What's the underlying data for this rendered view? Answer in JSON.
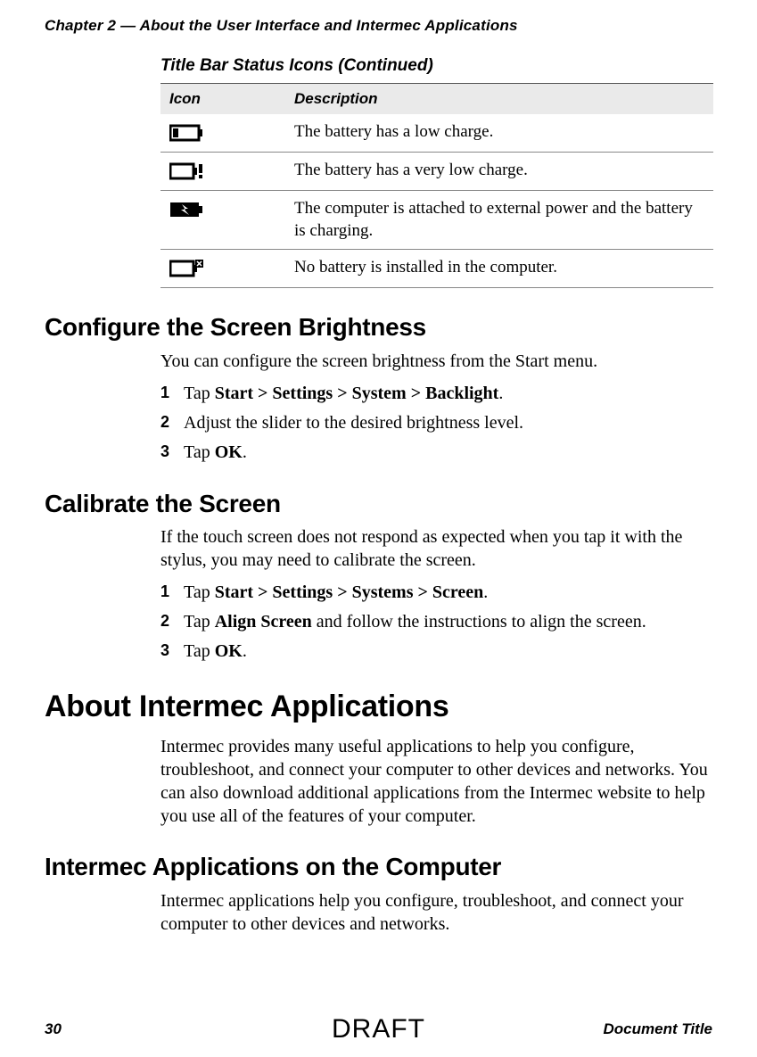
{
  "header": "Chapter 2 — About the User Interface and Intermec Applications",
  "table": {
    "title": "Title Bar Status Icons  (Continued)",
    "col_icon": "Icon",
    "col_desc": "Description",
    "rows": {
      "r0": {
        "icon_name": "battery-low-icon",
        "desc": "The battery has a low charge."
      },
      "r1": {
        "icon_name": "battery-very-low-icon",
        "desc": "The battery has a very low charge."
      },
      "r2": {
        "icon_name": "battery-charging-icon",
        "desc": "The computer is attached to external power and the battery is charging."
      },
      "r3": {
        "icon_name": "battery-missing-icon",
        "desc": "No battery is installed in the computer."
      }
    }
  },
  "sections": {
    "brightness": {
      "title": "Configure the Screen Brightness",
      "intro": "You can configure the screen brightness from the Start menu.",
      "steps": {
        "s1_pre": "Tap ",
        "s1_bold": "Start > Settings > System > Backlight",
        "s1_post": ".",
        "s2": "Adjust the slider to the desired brightness level.",
        "s3_pre": "Tap ",
        "s3_bold": "OK",
        "s3_post": "."
      }
    },
    "calibrate": {
      "title": "Calibrate the Screen",
      "intro": "If the touch screen does not respond as expected when you tap it with the stylus, you may need to calibrate the screen.",
      "steps": {
        "s1_pre": "Tap ",
        "s1_bold": "Start > Settings > Systems > Screen",
        "s1_post": ".",
        "s2_pre": "Tap ",
        "s2_bold": "Align Screen",
        "s2_post": " and follow the instructions to align the screen.",
        "s3_pre": "Tap ",
        "s3_bold": "OK",
        "s3_post": "."
      }
    },
    "about_apps": {
      "title": "About Intermec Applications",
      "body": "Intermec provides many useful applications to help you configure, troubleshoot, and connect your computer to other devices and networks. You can also download additional applications from the Intermec website to help you use all of the features of your computer."
    },
    "apps_computer": {
      "title": "Intermec Applications on the Computer",
      "body": "Intermec applications help you configure, troubleshoot, and connect your computer to other devices and networks."
    }
  },
  "nums": {
    "n1": "1",
    "n2": "2",
    "n3": "3"
  },
  "footer": {
    "page": "30",
    "doc_title": "Document Title",
    "draft": "DRAFT"
  }
}
